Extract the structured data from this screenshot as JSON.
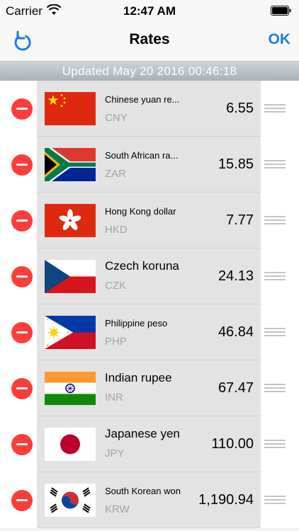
{
  "status_bar": {
    "carrier": "Carrier",
    "time": "12:47 AM"
  },
  "nav": {
    "title": "Rates",
    "ok_label": "OK",
    "refresh_icon": "refresh-icon"
  },
  "updated": {
    "text": "Updated May 20 2016 00:46:18"
  },
  "rates": [
    {
      "name": "Chinese yuan re...",
      "code": "CNY",
      "rate": "6.55",
      "flag": "cn-flag",
      "big": false
    },
    {
      "name": "South African ra...",
      "code": "ZAR",
      "rate": "15.85",
      "flag": "za-flag",
      "big": false
    },
    {
      "name": "Hong Kong dollar",
      "code": "HKD",
      "rate": "7.77",
      "flag": "hk-flag",
      "big": false
    },
    {
      "name": "Czech koruna",
      "code": "CZK",
      "rate": "24.13",
      "flag": "cz-flag",
      "big": true
    },
    {
      "name": "Philippine peso",
      "code": "PHP",
      "rate": "46.84",
      "flag": "ph-flag",
      "big": false
    },
    {
      "name": "Indian rupee",
      "code": "INR",
      "rate": "67.47",
      "flag": "in-flag",
      "big": true
    },
    {
      "name": "Japanese yen",
      "code": "JPY",
      "rate": "110.00",
      "flag": "jp-flag",
      "big": true
    },
    {
      "name": "South Korean won",
      "code": "KRW",
      "rate": "1,190.94",
      "flag": "kr-flag",
      "big": false
    }
  ],
  "colors": {
    "accent": "#1a7fe0",
    "delete": "#fc3d39",
    "code_gray": "#a4a4a4"
  }
}
